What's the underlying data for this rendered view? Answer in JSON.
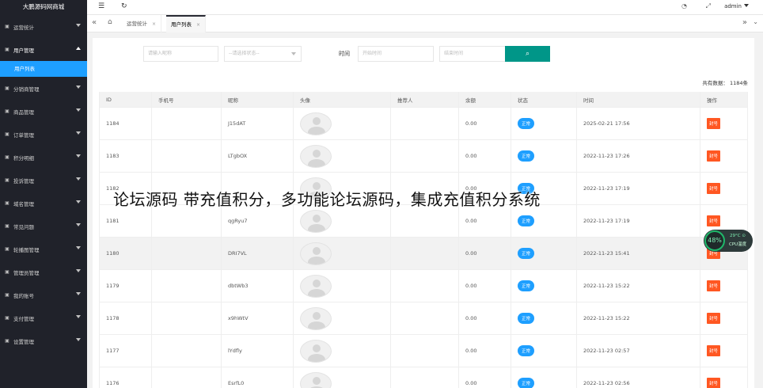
{
  "brand": "大鹏源码网商城",
  "sidebar": {
    "items": [
      {
        "label": "运营统计",
        "icon": "chart-icon"
      },
      {
        "label": "用户管理",
        "icon": "user-icon",
        "open": true
      },
      {
        "label": "分销商管理",
        "icon": "distributor-icon"
      },
      {
        "label": "商品管理",
        "icon": "goods-icon"
      },
      {
        "label": "订单管理",
        "icon": "order-icon"
      },
      {
        "label": "积分明细",
        "icon": "points-icon"
      },
      {
        "label": "投诉管理",
        "icon": "complaint-icon"
      },
      {
        "label": "域名管理",
        "icon": "domain-icon"
      },
      {
        "label": "常见问题",
        "icon": "faq-icon"
      },
      {
        "label": "轮播图管理",
        "icon": "carousel-icon"
      },
      {
        "label": "管理员管理",
        "icon": "admin-icon"
      },
      {
        "label": "我的账号",
        "icon": "account-icon"
      },
      {
        "label": "支付管理",
        "icon": "pay-icon"
      },
      {
        "label": "设置管理",
        "icon": "settings-icon"
      }
    ],
    "sub_item": "用户列表"
  },
  "header": {
    "user": "admin"
  },
  "tabs": [
    {
      "label": "运营统计"
    },
    {
      "label": "用户列表",
      "active": true
    }
  ],
  "filters": {
    "nickname_placeholder": "请输入昵称",
    "status_placeholder": "--请选择状态--",
    "time_label": "时间",
    "start_placeholder": "开始时间",
    "end_placeholder": "结束时间"
  },
  "total": "共有数据：  1184条",
  "table": {
    "headers": [
      "ID",
      "手机号",
      "昵称",
      "头像",
      "推荐人",
      "余额",
      "状态",
      "时间",
      "操作"
    ],
    "rows": [
      {
        "id": "1184",
        "phone": "",
        "nick": "J15dAT",
        "ref": "",
        "balance": "0.00",
        "status": "正常",
        "time": "2025-02-21 17:56",
        "action": "封号"
      },
      {
        "id": "1183",
        "phone": "",
        "nick": "LTgbOX",
        "ref": "",
        "balance": "0.00",
        "status": "正常",
        "time": "2022-11-23 17:26",
        "action": "封号"
      },
      {
        "id": "1182",
        "phone": "",
        "nick": "",
        "ref": "",
        "balance": "0.00",
        "status": "正常",
        "time": "2022-11-23 17:19",
        "action": "封号"
      },
      {
        "id": "1181",
        "phone": "",
        "nick": "qgRyu7",
        "ref": "",
        "balance": "0.00",
        "status": "正常",
        "time": "2022-11-23 17:19",
        "action": "封号"
      },
      {
        "id": "1180",
        "phone": "",
        "nick": "DRI7VL",
        "ref": "",
        "balance": "0.00",
        "status": "正常",
        "time": "2022-11-23 15:41",
        "action": "封号"
      },
      {
        "id": "1179",
        "phone": "",
        "nick": "dbtWb3",
        "ref": "",
        "balance": "0.00",
        "status": "正常",
        "time": "2022-11-23 15:22",
        "action": "封号"
      },
      {
        "id": "1178",
        "phone": "",
        "nick": "x9hWtV",
        "ref": "",
        "balance": "0.00",
        "status": "正常",
        "time": "2022-11-23 15:22",
        "action": "封号"
      },
      {
        "id": "1177",
        "phone": "",
        "nick": "lYdfly",
        "ref": "",
        "balance": "0.00",
        "status": "正常",
        "time": "2022-11-23 02:57",
        "action": "封号"
      },
      {
        "id": "1176",
        "phone": "",
        "nick": "EsrfL0",
        "ref": "",
        "balance": "0.00",
        "status": "正常",
        "time": "2022-11-23 02:56",
        "action": "封号"
      }
    ]
  },
  "watermark": "论坛源码 带充值积分，多功能论坛源码，集成充值积分系统",
  "cpu_widget": {
    "percent": "48%",
    "temp": "29°C ⊙",
    "label": "CPU温度"
  }
}
